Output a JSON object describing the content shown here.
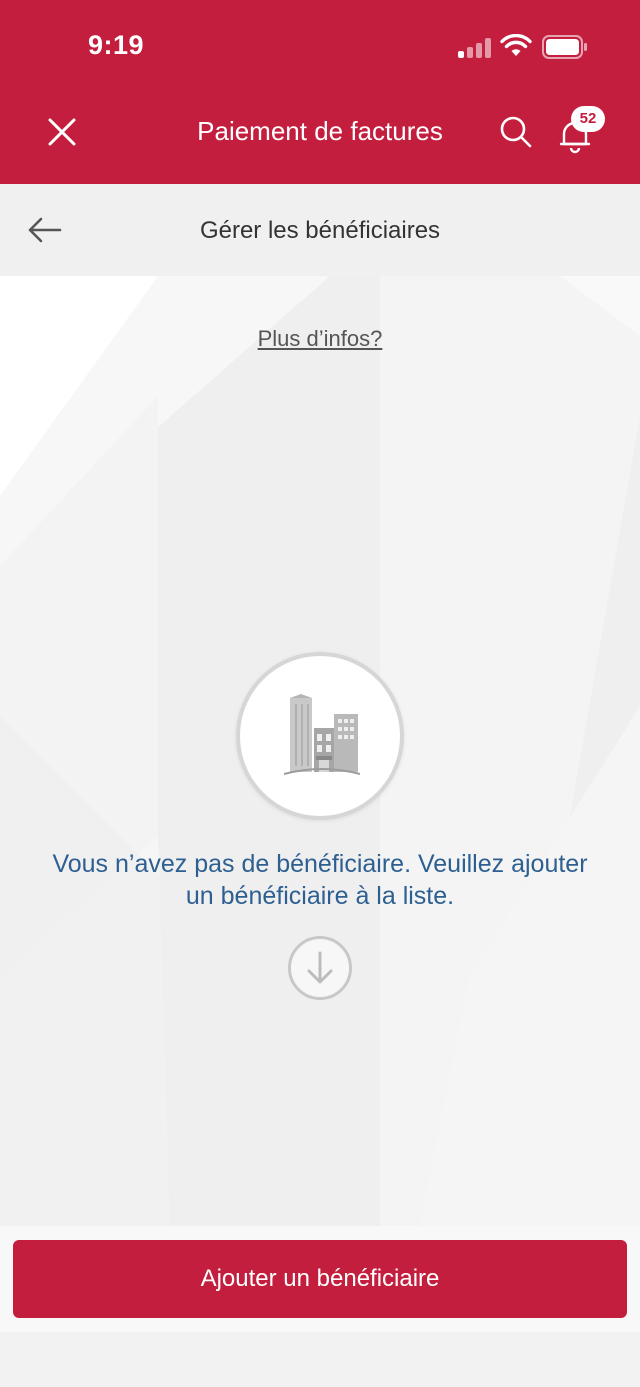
{
  "status_bar": {
    "time": "9:19",
    "icons": [
      "signal-icon",
      "wifi-icon",
      "battery-icon"
    ]
  },
  "header": {
    "title": "Paiement de factures",
    "close_icon": "close-icon",
    "search_icon": "search-icon",
    "bell_icon": "bell-icon",
    "notification_count": "52"
  },
  "subheader": {
    "title": "Gérer les bénéficiaires",
    "back_icon": "back-arrow-icon"
  },
  "content": {
    "more_info_link": "Plus d’infos?",
    "illustration_icon": "building-icon",
    "empty_message": "Vous n’avez pas de bénéficiaire. Veuillez ajouter un bénéficiaire à la liste.",
    "down_icon": "arrow-down-circle-icon"
  },
  "footer": {
    "add_button_label": "Ajouter un bénéficiaire"
  },
  "colors": {
    "brand": "#c41e3f",
    "message_text": "#2d5f91",
    "background": "#efefef"
  }
}
